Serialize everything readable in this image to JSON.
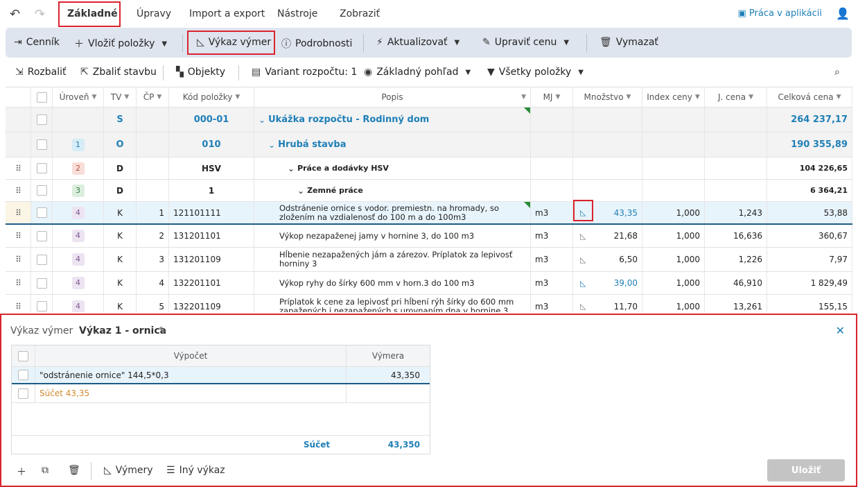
{
  "menubar": {
    "tabs": [
      "Základné",
      "Úpravy",
      "Import a export",
      "Nástroje",
      "Zobraziť"
    ],
    "praca": "Práca v aplikácii"
  },
  "ribbon": {
    "cennik": "Cenník",
    "vlozit": "Vložiť položky",
    "vykaz": "Výkaz výmer",
    "podrobnosti": "Podrobnosti",
    "aktualizovat": "Aktualizovať",
    "upravit": "Upraviť cenu",
    "vymazat": "Vymazať"
  },
  "toolbar2": {
    "rozbalit": "Rozbaliť",
    "zbalit": "Zbaliť stavbu",
    "objekty": "Objekty",
    "variant": "Variant rozpočtu: 1",
    "pohlad": "Základný pohľad",
    "polozky": "Všetky položky"
  },
  "grid": {
    "headers": {
      "uroven": "Úroveň",
      "tv": "TV",
      "cp": "ČP",
      "kod": "Kód položky",
      "popis": "Popis",
      "mj": "MJ",
      "mnozstvo": "Množstvo",
      "index": "Index ceny",
      "jcena": "J. cena",
      "celkova": "Celková cena"
    },
    "rows": [
      {
        "lvl": "",
        "tv": "S",
        "cp": "",
        "kod": "000-01",
        "popis": "Ukážka rozpočtu - Rodinný dom",
        "mj": "",
        "mnozstvo": "",
        "index": "",
        "jcena": "",
        "celkova": "264 237,17"
      },
      {
        "lvl": "1",
        "tv": "O",
        "cp": "",
        "kod": "010",
        "popis": "Hrubá stavba",
        "mj": "",
        "mnozstvo": "",
        "index": "",
        "jcena": "",
        "celkova": "190 355,89"
      },
      {
        "lvl": "2",
        "tv": "D",
        "cp": "",
        "kod": "HSV",
        "popis": "Práce a dodávky HSV",
        "mj": "",
        "mnozstvo": "",
        "index": "",
        "jcena": "",
        "celkova": "104 226,65"
      },
      {
        "lvl": "3",
        "tv": "D",
        "cp": "",
        "kod": "1",
        "popis": "Zemné práce",
        "mj": "",
        "mnozstvo": "",
        "index": "",
        "jcena": "",
        "celkova": "6 364,21"
      },
      {
        "lvl": "4",
        "tv": "K",
        "cp": "1",
        "kod": "121101111",
        "popis": "Odstránenie ornice s vodor. premiestn. na hromady, so zložením na vzdialenosť do 100 m a do 100m3",
        "mj": "m3",
        "mnozstvo": "43,35",
        "index": "1,000",
        "jcena": "1,243",
        "celkova": "53,88"
      },
      {
        "lvl": "4",
        "tv": "K",
        "cp": "2",
        "kod": "131201101",
        "popis": "Výkop nezapaženej jamy v hornine 3, do 100 m3",
        "mj": "m3",
        "mnozstvo": "21,68",
        "index": "1,000",
        "jcena": "16,636",
        "celkova": "360,67"
      },
      {
        "lvl": "4",
        "tv": "K",
        "cp": "3",
        "kod": "131201109",
        "popis": "Hĺbenie nezapažených jám a zárezov. Príplatok za lepivosť horniny 3",
        "mj": "m3",
        "mnozstvo": "6,50",
        "index": "1,000",
        "jcena": "1,226",
        "celkova": "7,97"
      },
      {
        "lvl": "4",
        "tv": "K",
        "cp": "4",
        "kod": "132201101",
        "popis": "Výkop ryhy do šírky 600 mm v horn.3 do 100 m3",
        "mj": "m3",
        "mnozstvo": "39,00",
        "index": "1,000",
        "jcena": "46,910",
        "celkova": "1 829,49"
      },
      {
        "lvl": "4",
        "tv": "K",
        "cp": "5",
        "kod": "132201109",
        "popis": "Príplatok k cene za lepivosť pri hĺbení rýh šírky do 600 mm zapažených i nezapažených s urovnaním dna v hornine 3",
        "mj": "m3",
        "mnozstvo": "11,70",
        "index": "1,000",
        "jcena": "13,261",
        "celkova": "155,15"
      }
    ]
  },
  "panel": {
    "title": "Výkaz výmer",
    "name": "Výkaz 1 - ornica",
    "headers": {
      "vypocet": "Výpočet",
      "vymera": "Výmera"
    },
    "rows": [
      {
        "vypocet": "\"odstránenie ornice\" 144,5*0,3",
        "vymera": "43,350"
      },
      {
        "vypocet": "Súčet 43,35",
        "vymera": ""
      }
    ],
    "sum_label": "Súčet",
    "sum_value": "43,350",
    "vymery": "Výmery",
    "iny": "Iný výkaz",
    "ulozit": "Uložiť"
  }
}
